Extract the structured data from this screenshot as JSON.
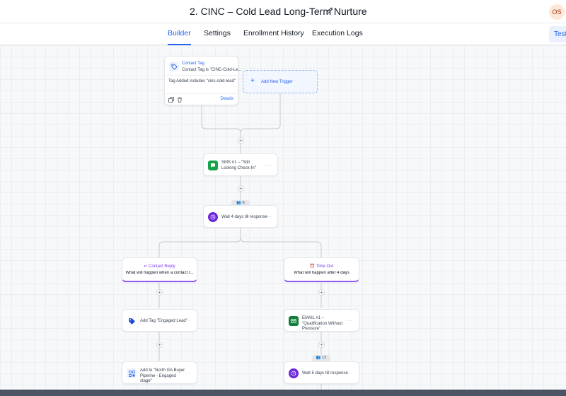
{
  "header": {
    "title": "2. CINC – Cold Lead Long-Term Nurture",
    "avatar_initials": "OS"
  },
  "tabs": [
    {
      "label": "Builder",
      "active": true
    },
    {
      "label": "Settings",
      "active": false
    },
    {
      "label": "Enrollment History",
      "active": false
    },
    {
      "label": "Execution Logs",
      "active": false
    }
  ],
  "test_button": "Test",
  "trigger": {
    "title": "Contact Tag",
    "subtitle": "Contact Tag is \"CINC-Cold-Le...",
    "condition": "Tag Added includes \"cinc-cold-lead\"",
    "details_label": "Details"
  },
  "add_trigger_label": "Add New Trigger",
  "actions": {
    "sms1": "SMS #1 – \"Still Looking Check-In\"",
    "wait1": "Wait 4 days till response",
    "add_tag": "Add Tag \"Engaged Lead\"",
    "pipeline": "Add to \"North GA Buyer Pipeline - Engaged stage\"",
    "email1": "EMAIL #1 – \"Qualification Without Pressure\"",
    "wait2": "Wait 5 days till response"
  },
  "counters": {
    "wait1": "6",
    "wait2": "13"
  },
  "branches": {
    "reply": {
      "title": "Contact Reply",
      "subtitle": "What will happen when a contact r..."
    },
    "timeout": {
      "title": "Time Out",
      "subtitle": "What will happen after 4 days"
    }
  },
  "colors": {
    "accent": "#2563eb",
    "sms": "#16a34a",
    "wait": "#6d28d9",
    "branch": "#8b5cf6",
    "tag": "#1d4ed8",
    "email": "#15803d"
  }
}
